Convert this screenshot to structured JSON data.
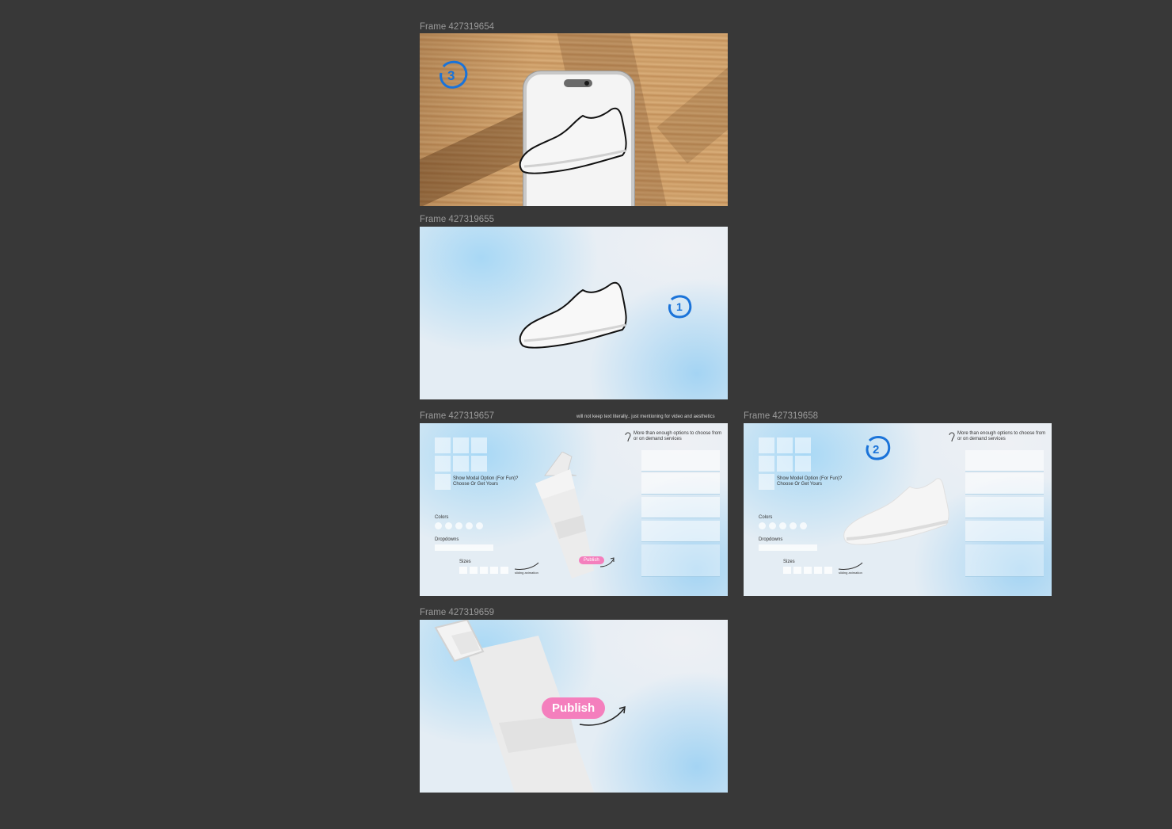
{
  "frames": [
    {
      "label": "Frame 427319654"
    },
    {
      "label": "Frame 427319655"
    },
    {
      "label": "Frame 427319657",
      "note": "will not keep text literally.. just mentioning for video and aesthetics",
      "options_note": "More than enough options to choose from or on demand services",
      "modal_text": "Show Modal Option (For Fun)? Choose Or Get Yours",
      "colors_label": "Colors",
      "dropdowns_label": "Dropdowns",
      "sizes_label": "Sizes",
      "scroll_note": "sliding animation",
      "publish_label": "Publish"
    },
    {
      "label": "Frame 427319658",
      "options_note": "More than enough options to choose from or on demand services",
      "modal_text": "Show Model Option (For Fun)? Choose Or Get Yours",
      "colors_label": "Colors",
      "dropdowns_label": "Dropdowns",
      "sizes_label": "Sizes",
      "scroll_note": "sliding animation"
    },
    {
      "label": "Frame 427319659",
      "publish_label": "Publish"
    }
  ],
  "annotations": {
    "num1": "1",
    "num2": "2",
    "num3": "3"
  },
  "colors": {
    "canvas": "#383838",
    "pink": "#f47fbd",
    "marker_blue": "#1a73d9"
  }
}
